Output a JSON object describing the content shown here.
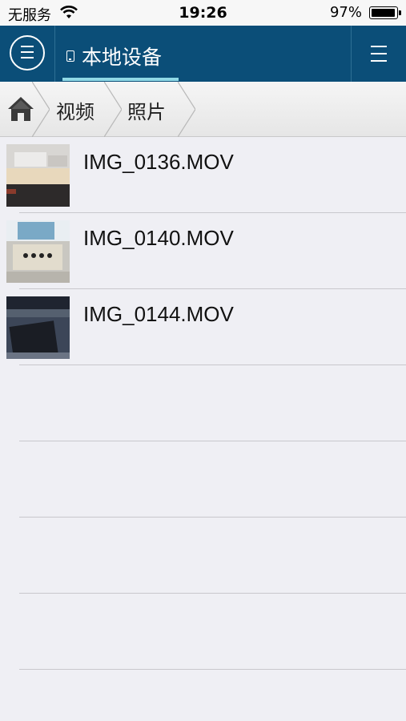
{
  "status_bar": {
    "carrier": "无服务",
    "time": "19:26",
    "battery_percent": "97%",
    "battery_level": 0.97
  },
  "nav": {
    "tab_label": "本地设备",
    "accent_color": "#8fd9e6",
    "bar_color": "#0b4e78"
  },
  "breadcrumb": {
    "home_icon": "home-icon",
    "items": [
      "视频",
      "照片"
    ]
  },
  "files": [
    {
      "name": "IMG_0136.MOV"
    },
    {
      "name": "IMG_0140.MOV"
    },
    {
      "name": "IMG_0144.MOV"
    }
  ]
}
